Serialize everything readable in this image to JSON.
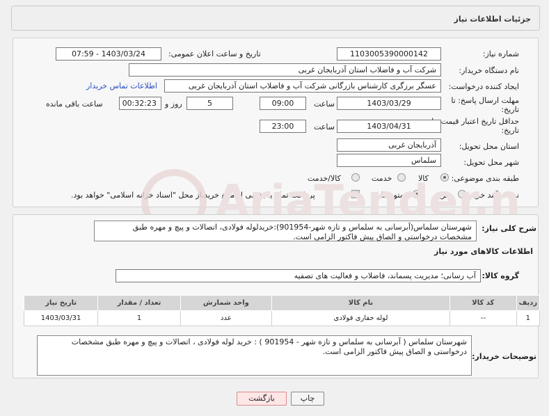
{
  "header": {
    "title": "جزئیات اطلاعات نیاز"
  },
  "form": {
    "need_number_label": "شماره نیاز:",
    "need_number": "1103005390000142",
    "announce_label": "تاریخ و ساعت اعلان عمومی:",
    "announce_value": "1403/03/24 - 07:59",
    "buyer_label": "نام دستگاه خریدار:",
    "buyer_value": "شرکت آب و فاضلاب استان آذربایجان غربی",
    "creator_label": "ایجاد کننده درخواست:",
    "creator_value": "عسگر  برزگری کارشناس بازرگانی شرکت آب و فاضلاب استان آذربایجان غربی",
    "contact_link": "اطلاعات تماس خریدار",
    "deadline_label_1": "مهلت ارسال پاسخ: تا",
    "deadline_label_2": "تاریخ:",
    "deadline_date": "1403/03/29",
    "time_label": "ساعت",
    "deadline_time": "09:00",
    "days_value": "5",
    "days_label": "روز و",
    "remaining_time": "00:32:23",
    "remaining_label": "ساعت باقی مانده",
    "validity_label_1": "حداقل تاریخ اعتبار قیمت: تا",
    "validity_label_2": "تاریخ:",
    "validity_date": "1403/04/31",
    "validity_time_label": "ساعت",
    "validity_time": "23:00",
    "province_label": "استان محل تحویل:",
    "province_value": "آذربایجان غربی",
    "city_label": "شهر محل تحویل:",
    "city_value": "سلماس",
    "category_label": "طبقه بندی موضوعی:",
    "category_options": [
      "کالا",
      "خدمت",
      "کالا/خدمت"
    ],
    "process_label": "نوع فرآیند خرید :",
    "process_options": [
      "جزیی",
      "متوسط"
    ],
    "payment_note": "پرداخت تمام یا بخشی از مبلغ خرید،از محل \"اسناد خزانه اسلامی\" خواهد بود."
  },
  "description": {
    "label": "شرح کلی نیاز:",
    "text": "شهرستان سلماس(آبرسانی به سلماس و تازه شهر-901954):خریدلوله فولادی، اتصالات و پیچ و مهره طبق مشخصات درخواستی و الصاق پیش فاکتور الزامی است."
  },
  "goods_info": {
    "title": "اطلاعات کالاهای مورد نیاز"
  },
  "goods_group": {
    "label": "گروه کالا:",
    "value": "آب رسانی؛ مدیریت پسماند، فاضلاب و فعالیت های تصفیه"
  },
  "table": {
    "headers": [
      "ردیف",
      "کد کالا",
      "نام کالا",
      "واحد شمارش",
      "تعداد / مقدار",
      "تاریخ نیاز"
    ],
    "rows": [
      {
        "row": "1",
        "code": "--",
        "name": "لوله حفاری فولادی",
        "unit": "عدد",
        "qty": "1",
        "date": "1403/03/31"
      }
    ]
  },
  "buyer_notes": {
    "label": "توضیحات خریدار:",
    "text": "شهرستان سلماس ( آبرسانی به سلماس و تازه شهر - 901954 ) : خرید  لوله فولادی ، اتصالات  و پیچ و مهره   طبق مشخصات درخواستی و الصاق پیش فاکتور الزامی است."
  },
  "buttons": {
    "print": "چاپ",
    "back": "بازگشت"
  },
  "watermark": {
    "text": "AriaTender.net"
  },
  "colors": {
    "link": "#2a4fc4",
    "back_button": "#fde6e6"
  }
}
